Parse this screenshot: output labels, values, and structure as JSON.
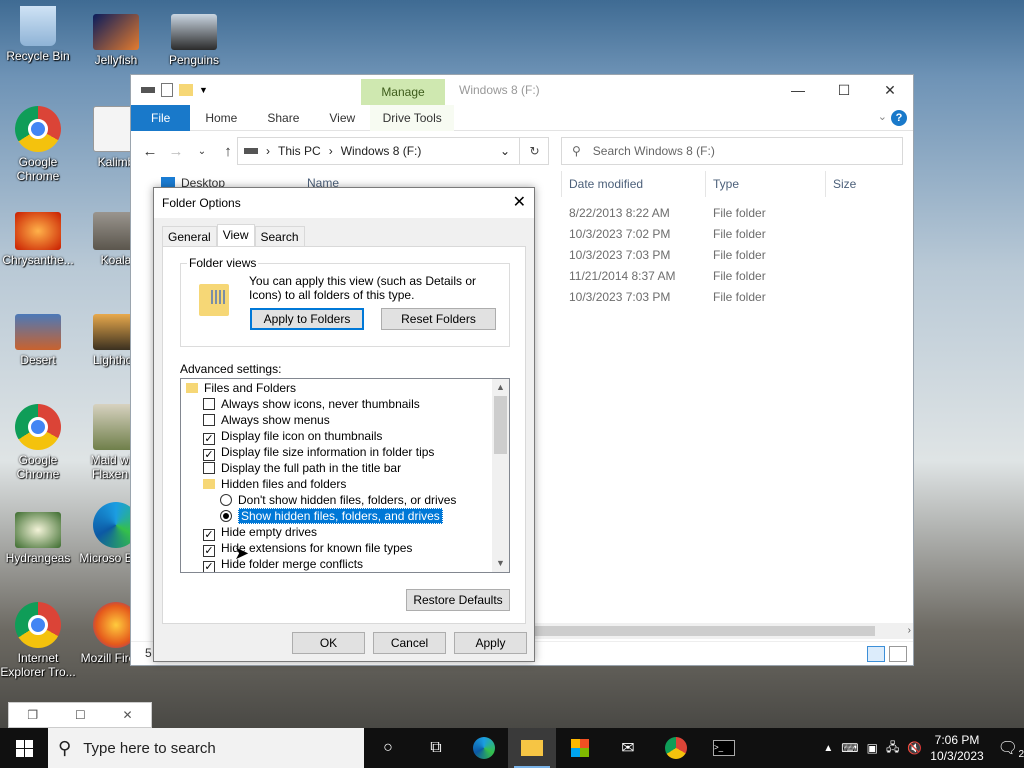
{
  "desktop": {
    "icons": [
      {
        "label": "Recycle Bin"
      },
      {
        "label": "Jellyfish"
      },
      {
        "label": "Penguins"
      },
      {
        "label": "Google Chrome"
      },
      {
        "label": "Kalimb"
      },
      {
        "label": "Chrysanthe..."
      },
      {
        "label": "Koala"
      },
      {
        "label": "Desert"
      },
      {
        "label": "Lighthou"
      },
      {
        "label": "Google Chrome"
      },
      {
        "label": "Maid with Flaxen H"
      },
      {
        "label": "Hydrangeas"
      },
      {
        "label": "Microso Edge"
      },
      {
        "label": "Internet Explorer Tro..."
      },
      {
        "label": "Mozill Firefox"
      }
    ]
  },
  "explorer": {
    "title": "Windows 8 (F:)",
    "manage_tab": "Manage",
    "ribbon_tabs": [
      "File",
      "Home",
      "Share",
      "View",
      "Drive Tools"
    ],
    "address": {
      "segments": [
        "This PC",
        "Windows 8 (F:)"
      ]
    },
    "search_placeholder": "Search Windows 8 (F:)",
    "nav_item": "Desktop",
    "columns": [
      "Name",
      "Date modified",
      "Type",
      "Size"
    ],
    "rows": [
      {
        "date": "8/22/2013 8:22 AM",
        "type": "File folder"
      },
      {
        "date": "10/3/2023 7:02 PM",
        "type": "File folder"
      },
      {
        "date": "10/3/2023 7:03 PM",
        "type": "File folder"
      },
      {
        "date": "11/21/2014 8:37 AM",
        "type": "File folder"
      },
      {
        "date": "10/3/2023 7:03 PM",
        "type": "File folder"
      }
    ],
    "status_count": "5"
  },
  "dialog": {
    "title": "Folder Options",
    "tabs": [
      "General",
      "View",
      "Search"
    ],
    "folder_views": {
      "label": "Folder views",
      "text": "You can apply this view (such as Details or Icons) to all folders of this type.",
      "apply_button": "Apply to Folders",
      "reset_button": "Reset Folders"
    },
    "advanced_label": "Advanced settings:",
    "tree": [
      {
        "kind": "folder",
        "indent": 0,
        "label": "Files and Folders"
      },
      {
        "kind": "check",
        "indent": 1,
        "checked": false,
        "label": "Always show icons, never thumbnails"
      },
      {
        "kind": "check",
        "indent": 1,
        "checked": false,
        "label": "Always show menus"
      },
      {
        "kind": "check",
        "indent": 1,
        "checked": true,
        "label": "Display file icon on thumbnails"
      },
      {
        "kind": "check",
        "indent": 1,
        "checked": true,
        "label": "Display file size information in folder tips"
      },
      {
        "kind": "check",
        "indent": 1,
        "checked": false,
        "label": "Display the full path in the title bar"
      },
      {
        "kind": "folder",
        "indent": 1,
        "label": "Hidden files and folders"
      },
      {
        "kind": "radio",
        "indent": 2,
        "checked": false,
        "label": "Don't show hidden files, folders, or drives"
      },
      {
        "kind": "radio",
        "indent": 2,
        "checked": true,
        "selected": true,
        "label": "Show hidden files, folders, and drives"
      },
      {
        "kind": "check",
        "indent": 1,
        "checked": true,
        "label": "Hide empty drives"
      },
      {
        "kind": "check",
        "indent": 1,
        "checked": true,
        "label": "Hide extensions for known file types"
      },
      {
        "kind": "check",
        "indent": 1,
        "checked": true,
        "label": "Hide folder merge conflicts"
      }
    ],
    "restore_button": "Restore Defaults",
    "ok_button": "OK",
    "cancel_button": "Cancel",
    "apply_button": "Apply"
  },
  "taskbar": {
    "search_placeholder": "Type here to search",
    "time": "7:06 PM",
    "date": "10/3/2023",
    "notification_count": "2"
  }
}
